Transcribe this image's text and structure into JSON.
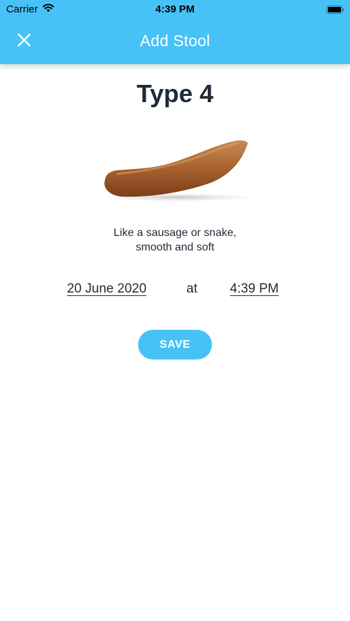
{
  "status_bar": {
    "carrier": "Carrier",
    "time": "4:39 PM",
    "icons": [
      "wifi-icon",
      "battery-icon"
    ]
  },
  "nav": {
    "title": "Add Stool",
    "close_icon": "close-icon"
  },
  "stool": {
    "type_label": "Type 4",
    "description_line1": "Like a sausage or snake,",
    "description_line2": "smooth and soft",
    "image": "stool-type-4-illustration"
  },
  "entry": {
    "date": "20 June 2020",
    "at_label": "at",
    "time": "4:39 PM"
  },
  "actions": {
    "save_label": "SAVE"
  },
  "colors": {
    "accent": "#47c2f7",
    "text": "#1e2a38",
    "stool_brown": "#a8612f"
  }
}
